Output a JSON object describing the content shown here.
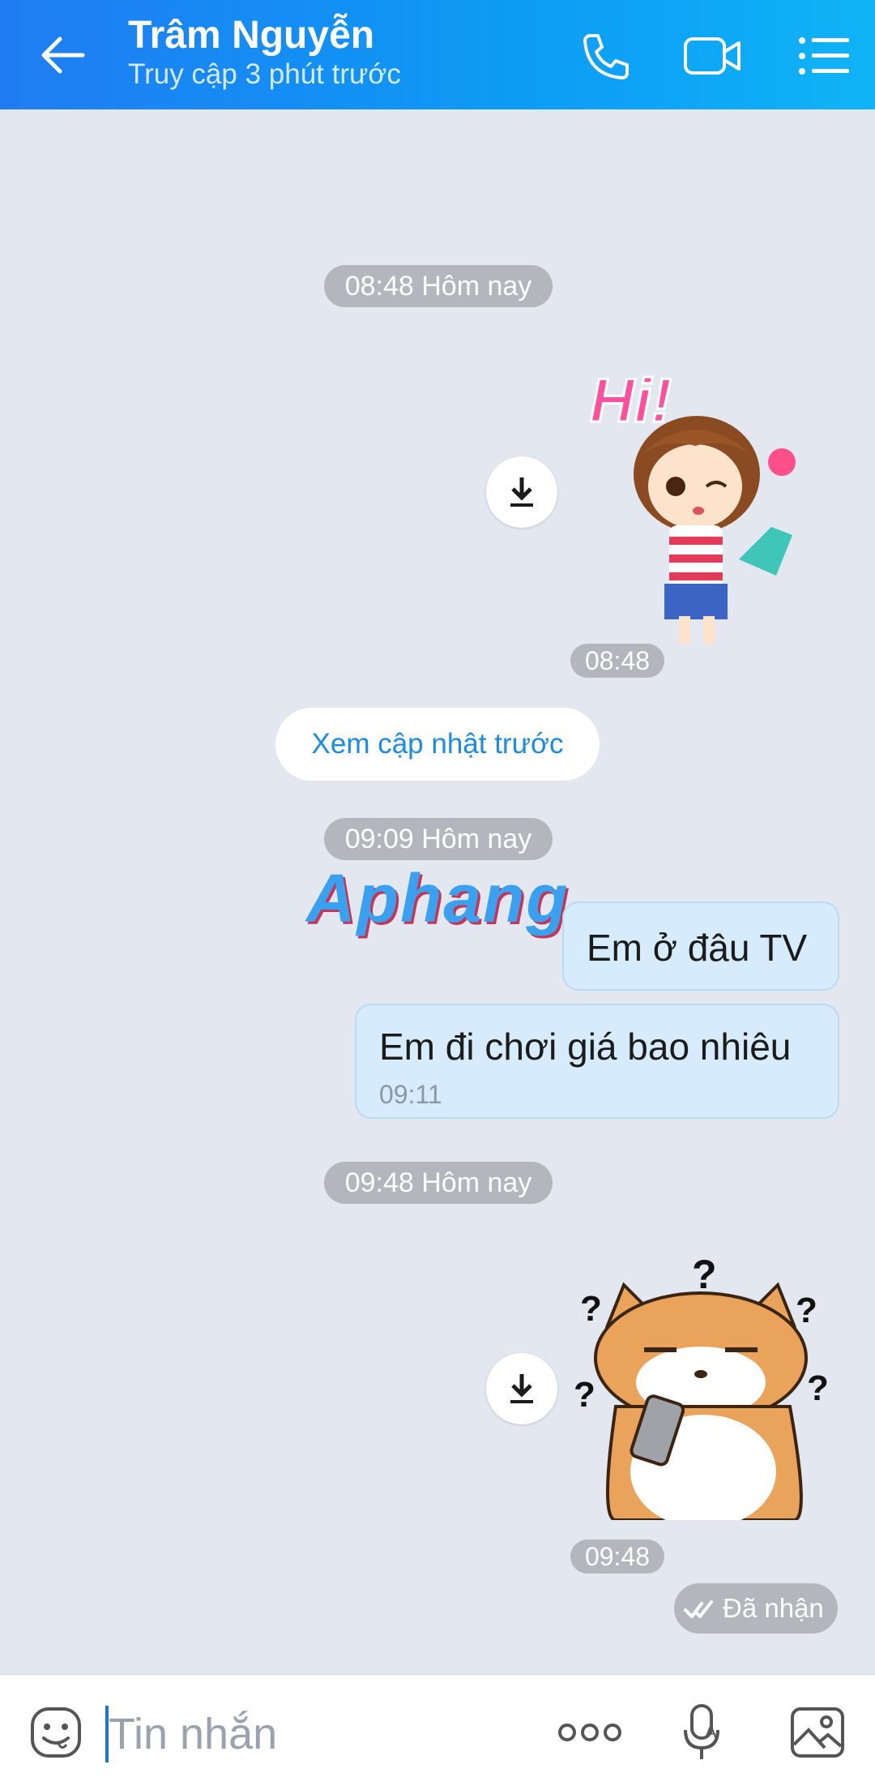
{
  "header": {
    "title": "Trâm Nguyễn",
    "subtitle": "Truy cập 3 phút trước",
    "icons": [
      "back-arrow-icon",
      "phone-icon",
      "video-call-icon",
      "menu-list-icon"
    ]
  },
  "chat": {
    "dividers": [
      "08:48 Hôm nay",
      "09:09 Hôm nay",
      "09:48 Hôm nay"
    ],
    "sticker1": {
      "caption": "Hi!",
      "time": "08:48"
    },
    "update_link": "Xem cập nhật trước",
    "watermark": "Aphang",
    "messages": [
      {
        "text": "Em ở đâu TV"
      },
      {
        "text": "Em đi chơi giá bao nhiêu",
        "time": "09:11"
      }
    ],
    "sticker2": {
      "time": "09:48"
    },
    "status": "Đã nhận"
  },
  "input": {
    "placeholder": "Tin nhắn",
    "icons": [
      "emoji-icon",
      "more-dots-icon",
      "voice-icon",
      "image-icon"
    ]
  },
  "colors": {
    "header_start": "#1f7cf2",
    "header_end": "#10b3f7",
    "background": "#e3e7ef",
    "bubble": "#d6ecfc",
    "pill": "#b3b6bc",
    "link": "#1a8be6"
  }
}
